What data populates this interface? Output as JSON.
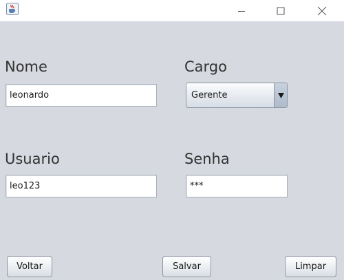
{
  "window": {
    "app_icon": "java-cup-icon",
    "controls": [
      "minimize-icon",
      "maximize-icon",
      "close-icon"
    ]
  },
  "form": {
    "nome_label": "Nome",
    "nome_value": "leonardo",
    "cargo_label": "Cargo",
    "cargo_value": "Gerente",
    "usuario_label": "Usuario",
    "usuario_value": "leo123",
    "senha_label": "Senha",
    "senha_value": "***"
  },
  "buttons": {
    "voltar": "Voltar",
    "salvar": "Salvar",
    "limpar": "Limpar"
  },
  "colors": {
    "panel_background": "#d6d9df",
    "titlebar_background": "#ffffff"
  }
}
